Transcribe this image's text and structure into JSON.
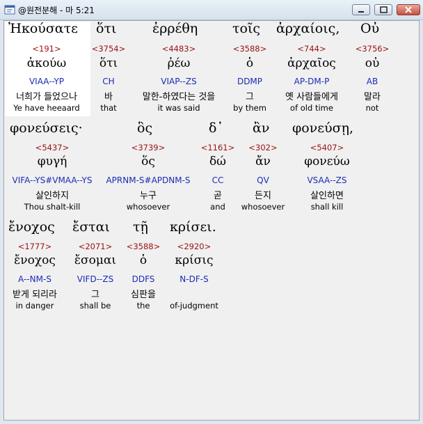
{
  "window": {
    "title": "@원전분해 - 마 5:21"
  },
  "rows": [
    {
      "words": [
        {
          "greek": "Ἠκούσατε",
          "strong": "<191>",
          "lemma": "ἀκούω",
          "morph": "VIAA--YP",
          "korean": "너희가 들었으나",
          "english": "Ye have heeaard",
          "selected": true
        },
        {
          "greek": "ὅτι",
          "strong": "<3754>",
          "lemma": "ὅτι",
          "morph": "CH",
          "korean": "바",
          "english": "that"
        },
        {
          "greek": "ἐρρέθη",
          "strong": "<4483>",
          "lemma": "ῥέω",
          "morph": "VIAP--ZS",
          "korean": "말한-하였다는 것을",
          "english": "it was said"
        },
        {
          "greek": "τοῖς",
          "strong": "<3588>",
          "lemma": "ὁ",
          "morph": "DDMP",
          "korean": "그",
          "english": "by them"
        },
        {
          "greek": "ἀρχαίοις,",
          "strong": "<744>",
          "lemma": "ἀρχαῖος",
          "morph": "AP-DM-P",
          "korean": "옛 사람들에게",
          "english": "of old time"
        },
        {
          "greek": "Οὐ",
          "strong": "<3756>",
          "lemma": "οὐ",
          "morph": "AB",
          "korean": "말라",
          "english": "not"
        }
      ]
    },
    {
      "words": [
        {
          "greek": "φονεύσεις·",
          "strong": "<5437>",
          "lemma": "φυγή",
          "morph": "VIFA--YS#VMAA--YS",
          "korean": "살인하지",
          "english": "Thou shalt-kill"
        },
        {
          "greek": "ὃς",
          "strong": "<3739>",
          "lemma": "ὅς",
          "morph": "APRNM-S#APDNM-S",
          "korean": "누구",
          "english": "whosoever"
        },
        {
          "greek": "δ᾽",
          "strong": "<1161>",
          "lemma": "δώ",
          "morph": "CC",
          "korean": "곧",
          "english": "and"
        },
        {
          "greek": "ἂν",
          "strong": "<302>",
          "lemma": "ἄν",
          "morph": "QV",
          "korean": "든지",
          "english": "whosoever"
        },
        {
          "greek": "φονεύσῃ,",
          "strong": "<5407>",
          "lemma": "φονεύω",
          "morph": "VSAA--ZS",
          "korean": "살인하면",
          "english": "shall kill"
        }
      ]
    },
    {
      "words": [
        {
          "greek": "ἔνοχος",
          "strong": "<1777>",
          "lemma": "ἔνοχος",
          "morph": "A--NM-S",
          "korean": "받게 되리라",
          "english": "in danger"
        },
        {
          "greek": "ἔσται",
          "strong": "<2071>",
          "lemma": "ἔσομαι",
          "morph": "VIFD--ZS",
          "korean": "그",
          "english": "shall be"
        },
        {
          "greek": "τῇ",
          "strong": "<3588>",
          "lemma": "ὁ",
          "morph": "DDFS",
          "korean": "심판을",
          "english": "the"
        },
        {
          "greek": "κρίσει.",
          "strong": "<2920>",
          "lemma": "κρίσις",
          "morph": "N-DF-S",
          "korean": "",
          "english": "of-judgment"
        }
      ]
    }
  ],
  "colors": {
    "strong": "#9b1010",
    "morph": "#1a2bb5",
    "selection": "#ffffff"
  }
}
